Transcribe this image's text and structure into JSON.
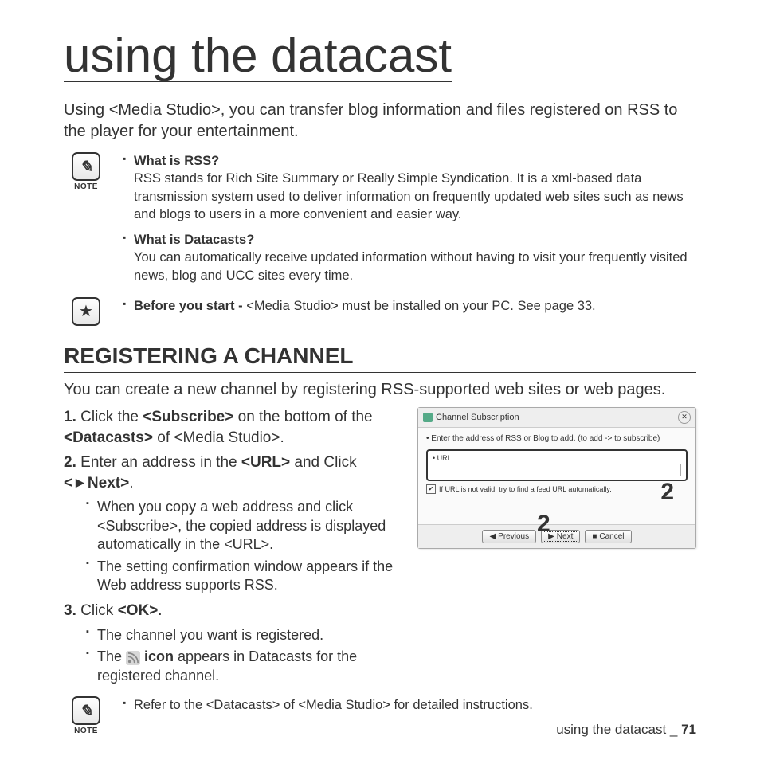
{
  "title": "using the datacast",
  "intro": "Using <Media Studio>, you can transfer blog information and files registered on RSS to the player for your entertainment.",
  "note1": {
    "label": "NOTE",
    "items": [
      {
        "q": "What is RSS?",
        "a": "RSS stands for Rich Site Summary or Really Simple Syndication. It is a xml-based data transmission system used to deliver information on frequently updated web sites such as news and blogs to users in a more convenient and easier way."
      },
      {
        "q": "What is Datacasts?",
        "a": "You can automatically receive updated information without having to visit your frequently visited news, blog and UCC sites every time."
      }
    ]
  },
  "star": {
    "prefix": "Before you start - ",
    "text": "<Media Studio> must be installed on your PC. See page 33."
  },
  "section": "REGISTERING A CHANNEL",
  "lead": "You can create a new channel by registering RSS-supported web sites or web pages.",
  "steps": {
    "s1_num": "1.",
    "s1_a": "Click the ",
    "s1_b": "<Subscribe>",
    "s1_c": " on the bottom of the ",
    "s1_d": "<Datacasts>",
    "s1_e": " of <Media Studio>.",
    "s2_num": "2.",
    "s2_a": "Enter an address in the ",
    "s2_b": "<URL>",
    "s2_c": " and Click ",
    "s2_d": "<►Next>",
    "s2_e": ".",
    "s2_sub": [
      "When you copy a web address and click <Subscribe>, the copied address is displayed automatically in the <URL>.",
      "The setting confirmation window appears if the Web address supports RSS."
    ],
    "s3_num": "3.",
    "s3_a": "Click ",
    "s3_b": "<OK>",
    "s3_c": ".",
    "s3_sub1": "The channel you want is registered.",
    "s3_sub2a": "The ",
    "s3_sub2b": " icon",
    "s3_sub2c": " appears in Datacasts for the registered channel."
  },
  "note2": {
    "label": "NOTE",
    "text": "Refer to the <Datacasts> of <Media Studio> for detailed instructions."
  },
  "dialog": {
    "title": "Channel Subscription",
    "instr": "• Enter the address of RSS or Blog to add. (to add -> to subscribe)",
    "url_label": "• URL",
    "url_value": "",
    "auto": "If URL is not valid, try to find a feed URL automatically.",
    "btn_prev": "Previous",
    "btn_next": "Next",
    "btn_cancel": "Cancel"
  },
  "annotation": "2",
  "footer_text": "using the datacast _ ",
  "footer_page": "71"
}
